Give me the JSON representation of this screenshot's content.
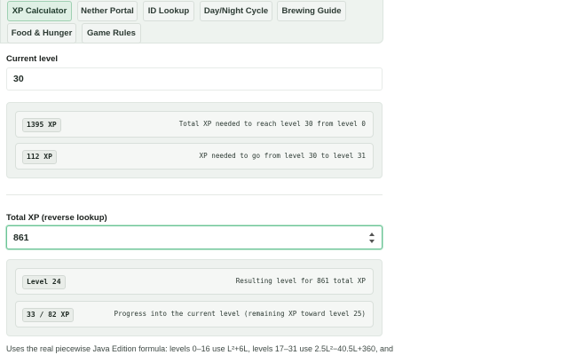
{
  "tabs": [
    {
      "label": "XP Calculator",
      "active": true
    },
    {
      "label": "Nether Portal",
      "active": false
    },
    {
      "label": "ID Lookup",
      "active": false
    },
    {
      "label": "Day/Night Cycle",
      "active": false
    },
    {
      "label": "Brewing Guide",
      "active": false
    },
    {
      "label": "Food & Hunger",
      "active": false
    },
    {
      "label": "Game Rules",
      "active": false
    }
  ],
  "current_level": {
    "label": "Current level",
    "value": "30",
    "results": [
      {
        "chip": "1395 XP",
        "desc": "Total XP needed to reach level 30 from level 0"
      },
      {
        "chip": "112 XP",
        "desc": "XP needed to go from level 30 to level 31"
      }
    ]
  },
  "total_xp": {
    "label": "Total XP (reverse lookup)",
    "value": "861",
    "results": [
      {
        "chip": "Level 24",
        "desc": "Resulting level for 861 total XP"
      },
      {
        "chip": "33 / 82 XP",
        "desc": "Progress into the current level (remaining XP toward level 25)"
      }
    ]
  },
  "footnote": "Uses the real piecewise Java Edition formula: levels 0–16 use L²+6L, levels 17–31 use 2.5L²−40.5L+360, and"
}
